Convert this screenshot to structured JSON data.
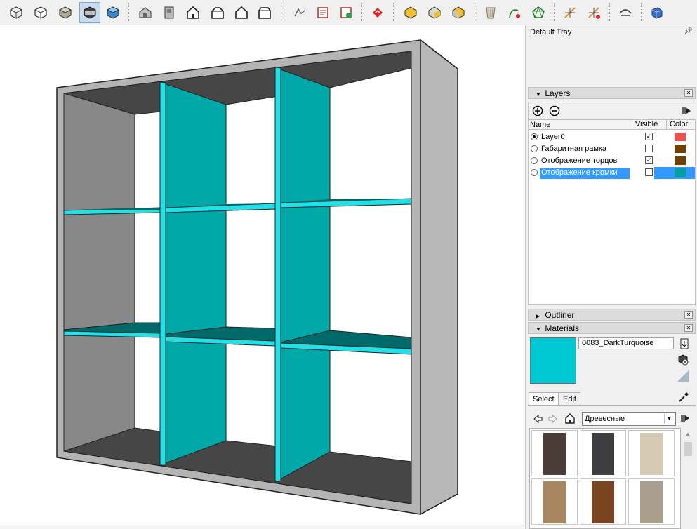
{
  "toolbar": {
    "icons": [
      "x-ray-style-icon",
      "wireframe-style-icon",
      "hidden-line-style-icon",
      "shaded-style-icon",
      "shaded-with-textures-style-icon",
      "iso-view-icon",
      "top-view-icon",
      "front-view-icon",
      "right-view-icon",
      "back-view-icon",
      "left-view-icon",
      "sandbox-tool-icon",
      "report-tool-icon",
      "report-export-icon",
      "plugin-red-icon",
      "solid-union-icon",
      "solid-subtract-icon",
      "solid-trim-icon",
      "texture-tool-icon",
      "curve-tool-icon",
      "shape-tool-icon",
      "axes-tool-icon",
      "axes-tool-alt-icon",
      "follow-me-icon",
      "section-cube-icon"
    ],
    "active_index": 3
  },
  "tray": {
    "title": "Default Tray",
    "pin_icon": "pin-icon"
  },
  "layers": {
    "title": "Layers",
    "columns": {
      "name": "Name",
      "visible": "Visible",
      "color": "Color"
    },
    "rows": [
      {
        "name": "Layer0",
        "active": true,
        "visible": true,
        "color": "#f05050"
      },
      {
        "name": "Габаритная рамка",
        "active": false,
        "visible": false,
        "color": "#704000"
      },
      {
        "name": "Отображение торцов",
        "active": false,
        "visible": true,
        "color": "#704000"
      },
      {
        "name": "Отображение кромки",
        "active": false,
        "visible": false,
        "color": "#00a0a0",
        "selected": true
      }
    ]
  },
  "outliner": {
    "title": "Outliner"
  },
  "materials": {
    "title": "Materials",
    "current_name": "0083_DarkTurquoise",
    "current_color": "#00c8d2",
    "tabs": [
      "Select",
      "Edit"
    ],
    "active_tab": 0,
    "library": "Древесные",
    "swatches": [
      "#4a3c36",
      "#3e3e40",
      "#d6cab4",
      "#a88660",
      "#7a4420",
      "#a8a08a"
    ]
  },
  "model": {
    "panel_color": "#00a8a8",
    "panel_edge_color": "#20e0e8",
    "frame_color": "#b4b4b4",
    "interior_color": "#464646"
  }
}
